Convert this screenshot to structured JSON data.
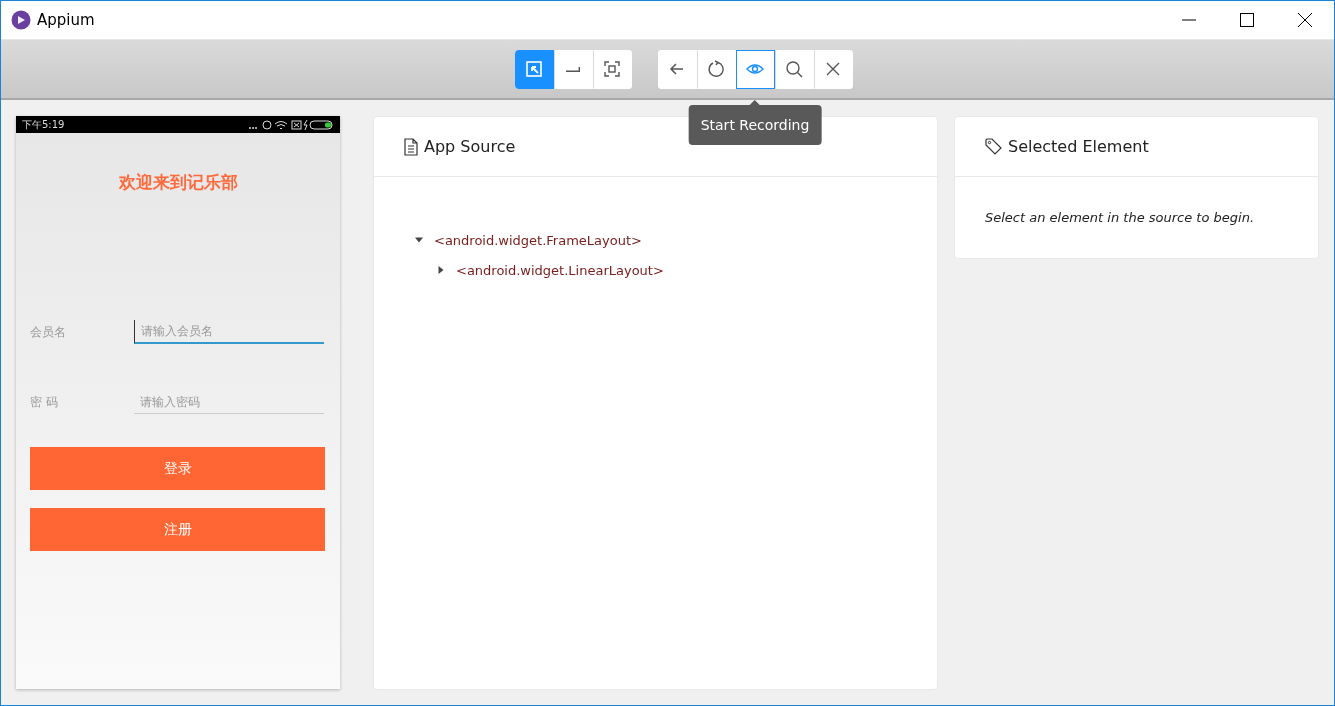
{
  "window": {
    "title": "Appium"
  },
  "toolbar": {
    "groups": [
      {
        "buttons": [
          {
            "kind": "select",
            "selected": true
          },
          {
            "kind": "swipe",
            "selected": false
          },
          {
            "kind": "tap",
            "selected": false
          }
        ]
      },
      {
        "buttons": [
          {
            "kind": "back",
            "selected": false
          },
          {
            "kind": "refresh",
            "selected": false
          },
          {
            "kind": "record",
            "selected": true
          },
          {
            "kind": "search",
            "selected": false
          },
          {
            "kind": "close",
            "selected": false
          }
        ]
      }
    ],
    "tooltip": "Start Recording"
  },
  "device": {
    "status_time": "下午5:19",
    "title": "欢迎来到记乐部",
    "fields": [
      {
        "label": "会员名",
        "placeholder": "请输入会员名",
        "focused": true
      },
      {
        "label": "密 码",
        "placeholder": "请输入密码",
        "focused": false
      }
    ],
    "buttons": [
      "登录",
      "注册"
    ]
  },
  "app_source": {
    "title": "App Source",
    "tree": [
      {
        "tag": "<android.widget.FrameLayout>",
        "expanded": true,
        "children": [
          {
            "tag": "<android.widget.LinearLayout>",
            "expanded": false
          }
        ]
      }
    ]
  },
  "selected_element": {
    "title": "Selected Element",
    "message": "Select an element in the source to begin."
  }
}
